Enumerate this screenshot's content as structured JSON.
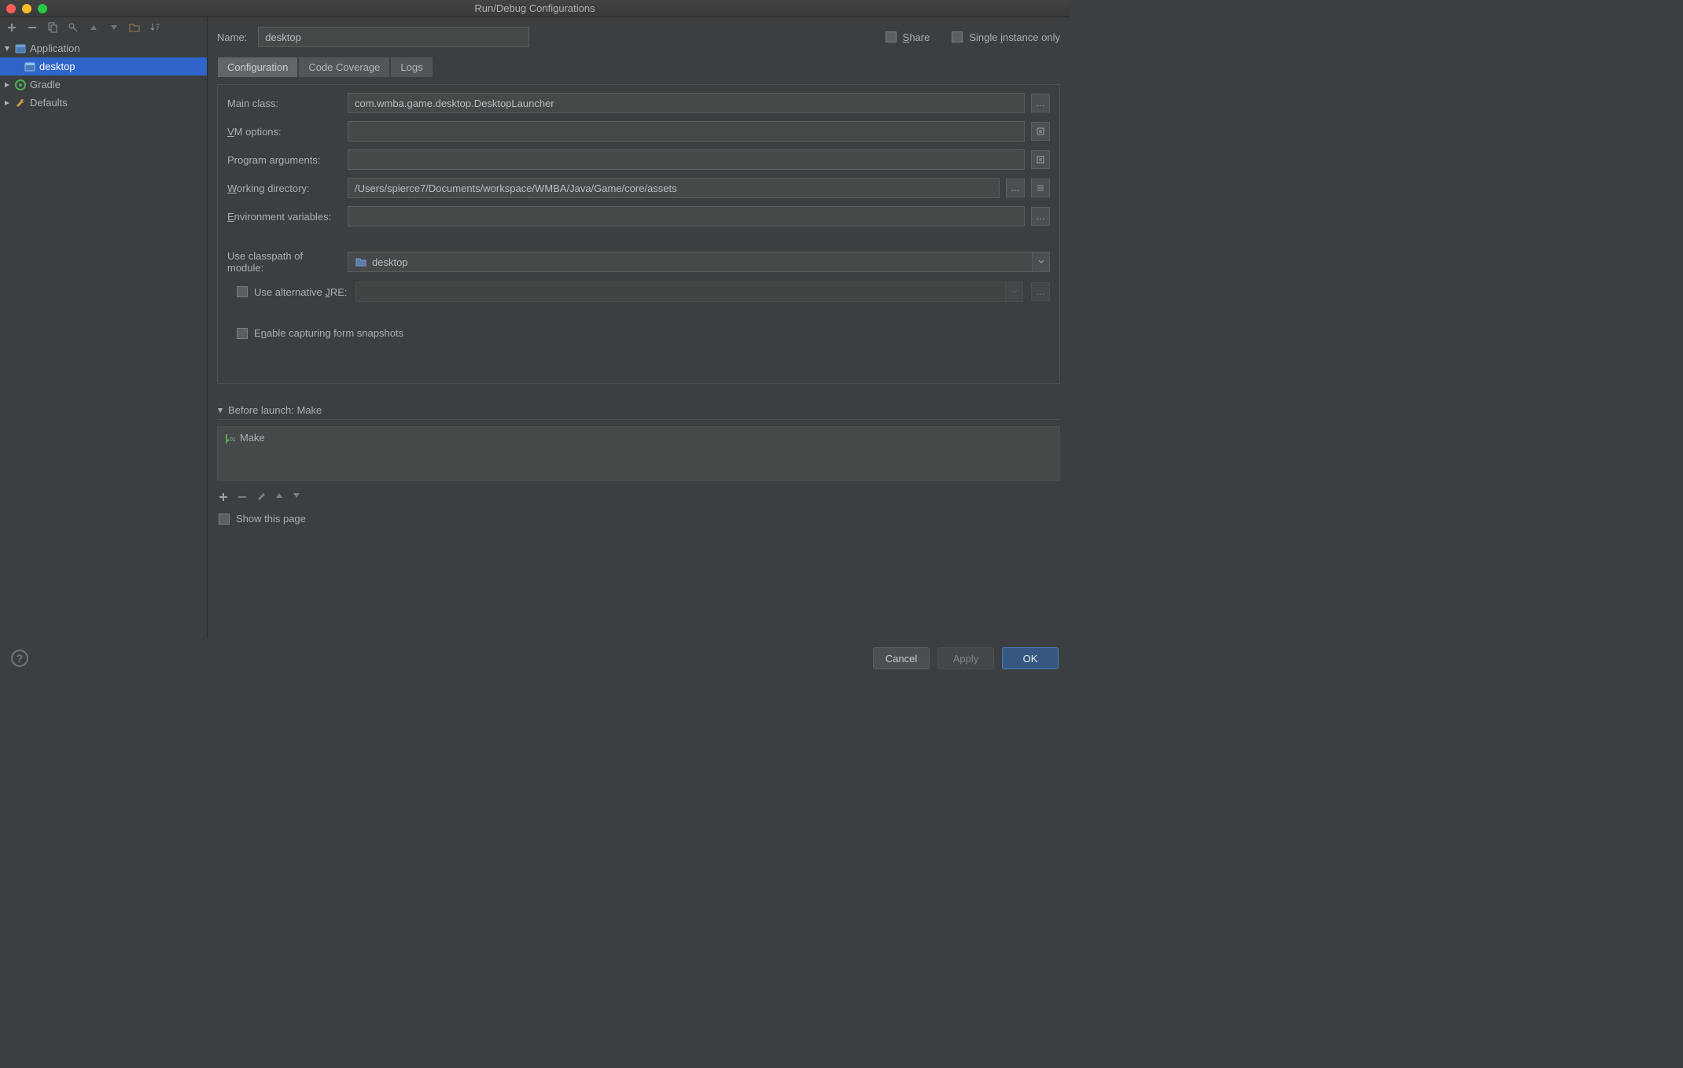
{
  "window_title": "Run/Debug Configurations",
  "name_label": "Name:",
  "name_value": "desktop",
  "share_label": "Share",
  "single_instance_label": "Single instance only",
  "tree": {
    "application": "Application",
    "desktop": "desktop",
    "gradle": "Gradle",
    "defaults": "Defaults"
  },
  "tabs": {
    "configuration": "Configuration",
    "code_coverage": "Code Coverage",
    "logs": "Logs"
  },
  "form": {
    "main_class_label": "Main class:",
    "main_class_value": "com.wmba.game.desktop.DesktopLauncher",
    "vm_options_label": "VM options:",
    "vm_options_value": "",
    "program_args_label": "Program arguments:",
    "program_args_value": "",
    "working_dir_label": "Working directory:",
    "working_dir_value": "/Users/spierce7/Documents/workspace/WMBA/Java/Game/core/assets",
    "env_vars_label": "Environment variables:",
    "env_vars_value": "",
    "classpath_label": "Use classpath of module:",
    "classpath_value": "desktop",
    "alt_jre_label": "Use alternative JRE:",
    "snapshots_label": "Enable capturing form snapshots"
  },
  "before_launch": {
    "header": "Before launch: Make",
    "item": "Make"
  },
  "show_this_page": "Show this page",
  "buttons": {
    "cancel": "Cancel",
    "apply": "Apply",
    "ok": "OK"
  }
}
